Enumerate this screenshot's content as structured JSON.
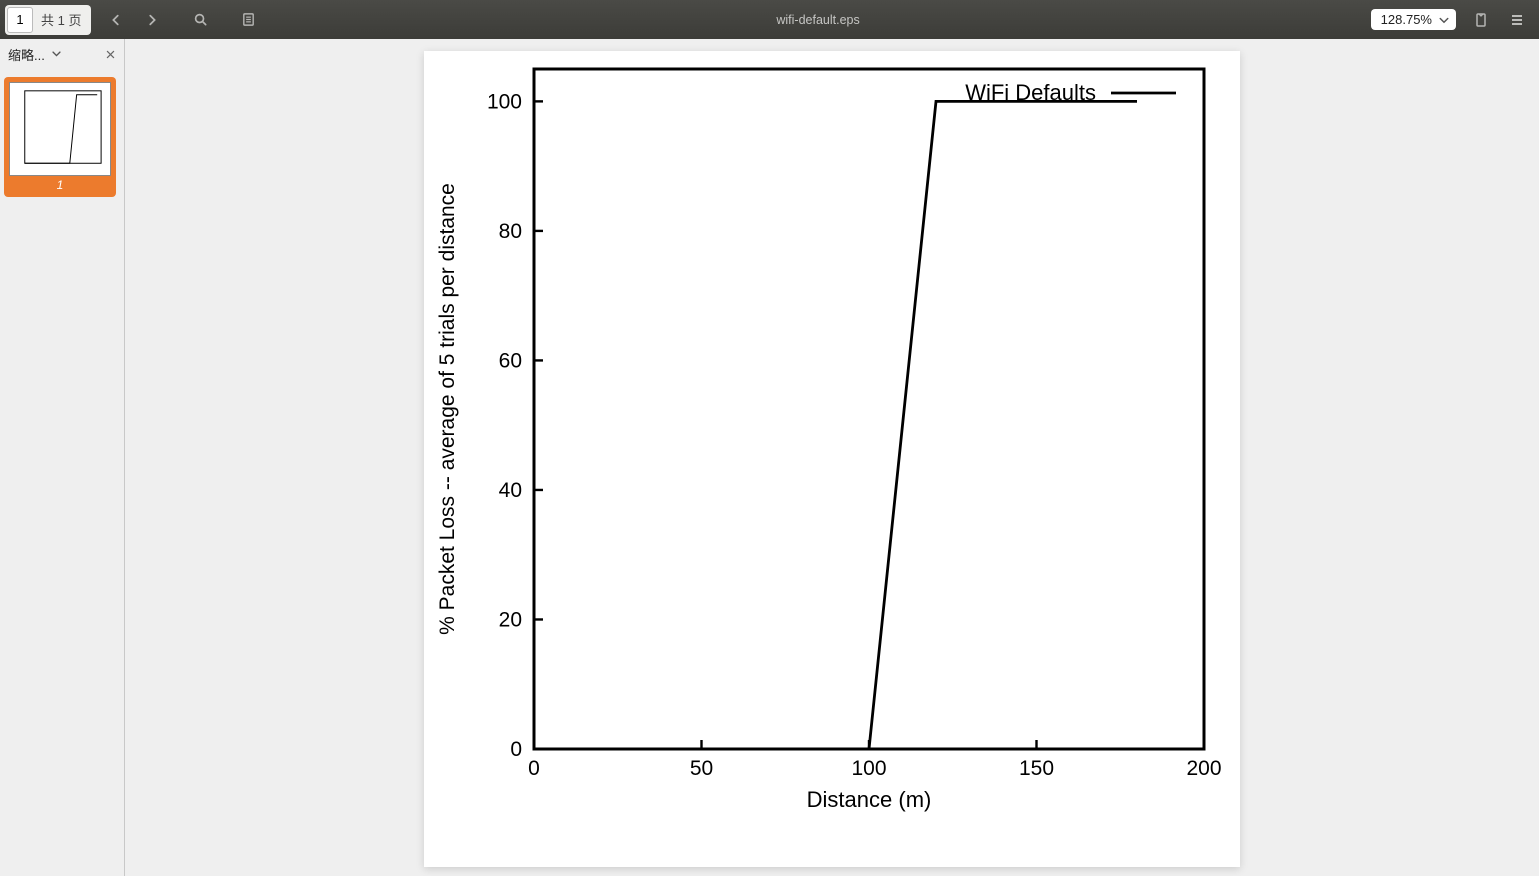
{
  "toolbar": {
    "page_current": "1",
    "page_total_label": "共 1 页",
    "doc_title": "wifi-default.eps",
    "zoom": "128.75%"
  },
  "sidebar": {
    "label": "缩略...",
    "thumb_page": "1"
  },
  "chart_data": {
    "type": "line",
    "xlabel": "Distance (m)",
    "ylabel": "% Packet Loss -- average of 5 trials per distance",
    "xlim": [
      0,
      200
    ],
    "ylim": [
      0,
      105
    ],
    "x_ticks": [
      0,
      50,
      100,
      150,
      200
    ],
    "y_ticks": [
      0,
      20,
      40,
      60,
      80,
      100
    ],
    "legend_position": "top-right",
    "series": [
      {
        "name": "WiFi Defaults",
        "x": [
          0,
          10,
          20,
          30,
          40,
          50,
          60,
          70,
          80,
          90,
          100,
          105,
          110,
          115,
          120,
          125,
          130,
          140,
          150,
          160,
          170,
          180
        ],
        "values": [
          0,
          0,
          0,
          0,
          0,
          0,
          0,
          0,
          0,
          0,
          0,
          25,
          50,
          75,
          100,
          100,
          100,
          100,
          100,
          100,
          100,
          100
        ]
      }
    ]
  }
}
